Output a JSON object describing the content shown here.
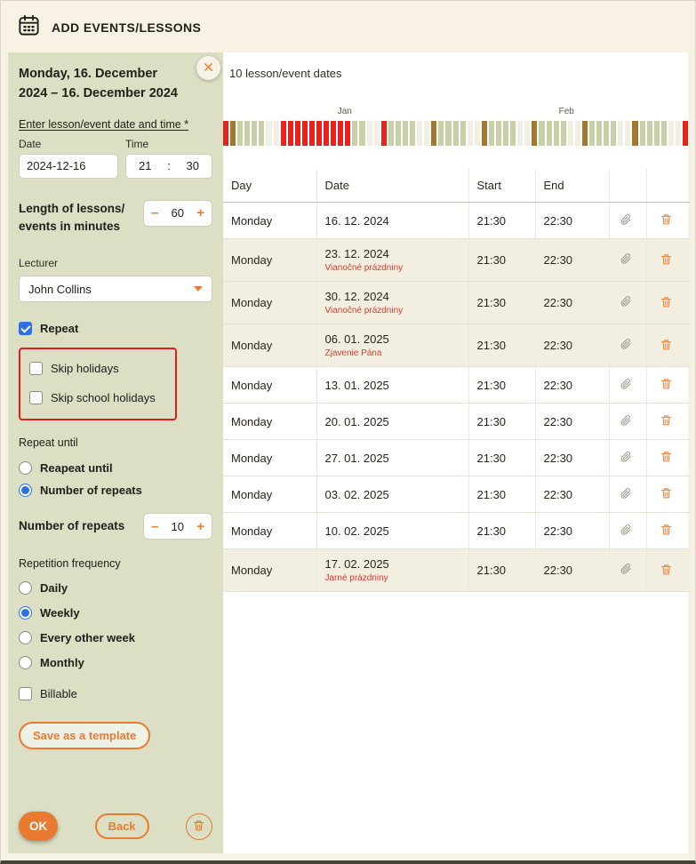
{
  "colors": {
    "accent_orange": "#e87b30",
    "sidebar_bg": "#dcdfc4",
    "page_bg": "#f7f2e4",
    "checkbox_blue": "#2f6fe4",
    "holiday_note_red": "#e03a2f",
    "red_outline_box": "#e01f1f",
    "highlight_row_bg": "#f2efe1"
  },
  "header": {
    "title": "ADD EVENTS/LESSONS"
  },
  "sidebar": {
    "date_range": "Monday, 16. December 2024 – 16. December 2024",
    "datetime_section_label": "Enter lesson/event date and time *",
    "date_field": {
      "label": "Date",
      "value": "2024-12-16"
    },
    "time_field": {
      "label": "Time",
      "hour": "21",
      "separator": ":",
      "minute": "30"
    },
    "length_stepper": {
      "label": "Length of lessons/ events in minutes",
      "minus": "–",
      "value": "60",
      "plus": "+"
    },
    "lecturer_field": {
      "label": "Lecturer",
      "value": "John Collins"
    },
    "repeat_checkbox": {
      "label": "Repeat",
      "checked": true
    },
    "skip_holidays_checkbox": {
      "label": "Skip holidays",
      "checked": false
    },
    "skip_school_holidays_checkbox": {
      "label": "Skip school holidays",
      "checked": false
    },
    "repeat_until_label": "Repeat until",
    "repeat_until_options": [
      {
        "label": "Reapeat until",
        "selected": false
      },
      {
        "label": "Number of repeats",
        "selected": true
      }
    ],
    "repeats_stepper": {
      "label": "Number of repeats",
      "minus": "–",
      "value": "10",
      "plus": "+"
    },
    "frequency_label": "Repetition frequency",
    "frequency_options": [
      {
        "label": "Daily",
        "selected": false
      },
      {
        "label": "Weekly",
        "selected": true
      },
      {
        "label": "Every other week",
        "selected": false
      },
      {
        "label": "Monthly",
        "selected": false
      }
    ],
    "billable_checkbox": {
      "label": "Billable",
      "checked": false
    },
    "save_template_button": "Save as a template",
    "ok_button": "OK",
    "back_button": "Back"
  },
  "main": {
    "count_text": "10 lesson/event dates",
    "timeline": {
      "months": [
        {
          "label": "Jan",
          "index": 17
        },
        {
          "label": "Feb",
          "index": 48
        }
      ],
      "colors": {
        "g": "#c9d0a8",
        "w": "#f1efe2",
        "r": "#e8221c",
        "b": "#a5762f"
      },
      "days": [
        "r",
        "b",
        "g",
        "g",
        "g",
        "g",
        "w",
        "w",
        "r",
        "r",
        "r",
        "r",
        "r",
        "r",
        "r",
        "r",
        "r",
        "r",
        "g",
        "g",
        "w",
        "w",
        "r",
        "g",
        "g",
        "g",
        "g",
        "w",
        "w",
        "b",
        "g",
        "g",
        "g",
        "g",
        "w",
        "w",
        "b",
        "g",
        "g",
        "g",
        "g",
        "w",
        "w",
        "b",
        "g",
        "g",
        "g",
        "g",
        "w",
        "w",
        "b",
        "g",
        "g",
        "g",
        "g",
        "w",
        "w",
        "b",
        "g",
        "g",
        "g",
        "g",
        "w",
        "w",
        "r"
      ]
    },
    "table": {
      "headers": {
        "day": "Day",
        "date": "Date",
        "start": "Start",
        "end": "End"
      },
      "rows": [
        {
          "day": "Monday",
          "date": "16. 12. 2024",
          "note": "",
          "start": "21:30",
          "end": "22:30",
          "highlight": false
        },
        {
          "day": "Monday",
          "date": "23. 12. 2024",
          "note": "Vianočné prázdniny",
          "start": "21:30",
          "end": "22:30",
          "highlight": true
        },
        {
          "day": "Monday",
          "date": "30. 12. 2024",
          "note": "Vianočné prázdniny",
          "start": "21:30",
          "end": "22:30",
          "highlight": true
        },
        {
          "day": "Monday",
          "date": "06. 01. 2025",
          "note": "Zjavenie Pána",
          "start": "21:30",
          "end": "22:30",
          "highlight": true
        },
        {
          "day": "Monday",
          "date": "13. 01. 2025",
          "note": "",
          "start": "21:30",
          "end": "22:30",
          "highlight": false
        },
        {
          "day": "Monday",
          "date": "20. 01. 2025",
          "note": "",
          "start": "21:30",
          "end": "22:30",
          "highlight": false
        },
        {
          "day": "Monday",
          "date": "27. 01. 2025",
          "note": "",
          "start": "21:30",
          "end": "22:30",
          "highlight": false
        },
        {
          "day": "Monday",
          "date": "03. 02. 2025",
          "note": "",
          "start": "21:30",
          "end": "22:30",
          "highlight": false
        },
        {
          "day": "Monday",
          "date": "10. 02. 2025",
          "note": "",
          "start": "21:30",
          "end": "22:30",
          "highlight": false
        },
        {
          "day": "Monday",
          "date": "17. 02. 2025",
          "note": "Jarné prázdniny",
          "start": "21:30",
          "end": "22:30",
          "highlight": true
        }
      ]
    }
  }
}
